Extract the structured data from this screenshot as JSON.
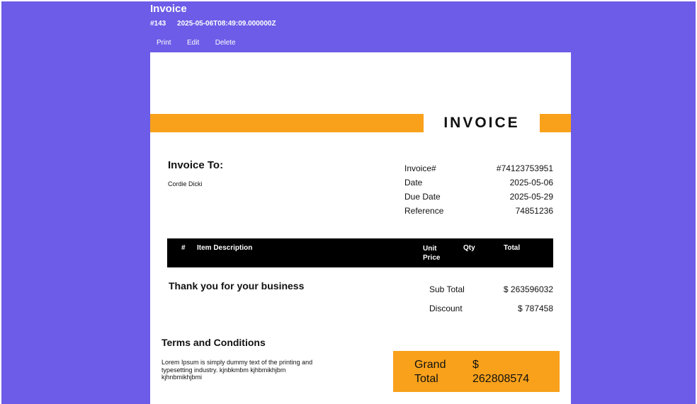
{
  "header": {
    "title": "Invoice",
    "id": "#143",
    "timestamp": "2025-05-06T08:49:09.000000Z"
  },
  "actions": {
    "print": "Print",
    "edit": "Edit",
    "delete": "Delete"
  },
  "document": {
    "heading": "INVOICE",
    "bill_to_title": "Invoice To:",
    "bill_to_name": "Cordie Dicki",
    "meta": [
      {
        "label": "Invoice#",
        "value": "#74123753951"
      },
      {
        "label": "Date",
        "value": "2025-05-06"
      },
      {
        "label": "Due Date",
        "value": "2025-05-29"
      },
      {
        "label": "Reference",
        "value": "74851236"
      }
    ],
    "table_headers": {
      "num": "#",
      "description": "Item Description",
      "unit_price_1": "Unit",
      "unit_price_2": "Price",
      "qty": "Qty",
      "total": "Total"
    },
    "thanks": "Thank you for your business",
    "sub_total_label": "Sub Total",
    "sub_total_value": "$ 263596032",
    "discount_label": "Discount",
    "discount_value": "$ 787458",
    "terms_title": "Terms and Conditions",
    "terms_text": "Lorem Ipsum is simply dummy text of the printing and typesetting industry. kjnbkmbm kjhbmikhjbm kjhnbmikhjbmi",
    "grand_label_1": "Grand",
    "grand_label_2": "Total",
    "grand_currency": "$",
    "grand_value": "262808574"
  },
  "colors": {
    "background": "#6c5ce7",
    "accent": "#f9a11b",
    "table_header": "#000000"
  }
}
